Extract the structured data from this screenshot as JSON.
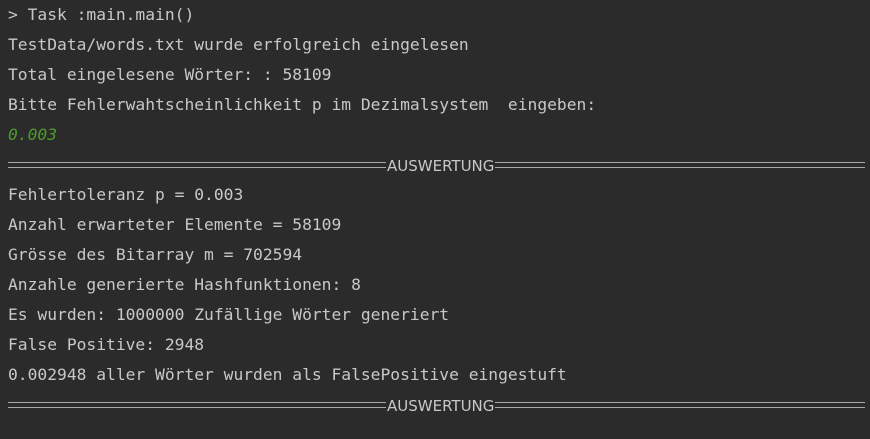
{
  "console": {
    "task_line": "> Task :main.main()",
    "loaded_file": "TestData/words.txt wurde erfolgreich eingelesen",
    "total_words": "Total eingelesene Wörter: : 58109",
    "prompt": "Bitte Fehlerwahtscheinlichkeit p im Dezimalsystem  eingeben:",
    "user_input": "0.003",
    "section_label": "AUSWERTUNG",
    "results": {
      "tolerance": "Fehlertoleranz p = 0.003",
      "expected_elements": "Anzahl erwarteter Elemente = 58109",
      "bitarray_size": "Grösse des Bitarray m = 702594",
      "hash_functions": "Anzahle generierte Hashfunktionen: 8",
      "random_words": "Es wurden: 1000000 Zufällige Wörter generiert",
      "false_positive": "False Positive: 2948",
      "false_positive_rate": "0.002948 aller Wörter wurden als FalsePositive eingestuft"
    }
  },
  "colors": {
    "background": "#2b2b2b",
    "text": "#c8c8c8",
    "input": "#4e9a2e"
  }
}
